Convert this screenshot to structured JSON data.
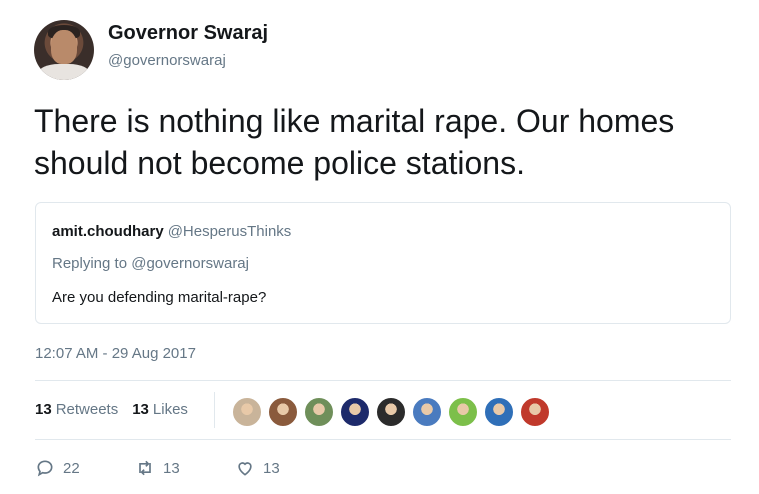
{
  "author": {
    "name": "Governor Swaraj",
    "handle": "@governorswaraj"
  },
  "tweet": {
    "text": "There is nothing like marital rape. Our homes should not become police stations."
  },
  "quoted_tweet": {
    "name": "amit.choudhary",
    "handle": "@HesperusThinks",
    "replying_to": "Replying to @governorswaraj",
    "text": "Are you defending marital-rape?"
  },
  "timestamp": "12:07 AM - 29 Aug 2017",
  "stats": {
    "retweets_count": "13",
    "retweets_label": "Retweets",
    "likes_count": "13",
    "likes_label": "Likes"
  },
  "liker_avatars": [
    {
      "icon": "avatar-1",
      "color": "#c9b49a"
    },
    {
      "icon": "avatar-2",
      "color": "#8a5a3c"
    },
    {
      "icon": "avatar-3",
      "color": "#6f8f5a"
    },
    {
      "icon": "avatar-4",
      "color": "#1d2a6b"
    },
    {
      "icon": "avatar-5",
      "color": "#2b2b2b"
    },
    {
      "icon": "avatar-6",
      "color": "#4a7bbf"
    },
    {
      "icon": "avatar-7",
      "color": "#7cbf4a"
    },
    {
      "icon": "avatar-8",
      "color": "#2f6fb8"
    },
    {
      "icon": "avatar-9",
      "color": "#c0392b"
    }
  ],
  "actions": {
    "reply_count": "22",
    "retweet_count": "13",
    "like_count": "13"
  },
  "colors": {
    "text": "#14171a",
    "secondary": "#657786",
    "border": "#e1e8ed"
  }
}
